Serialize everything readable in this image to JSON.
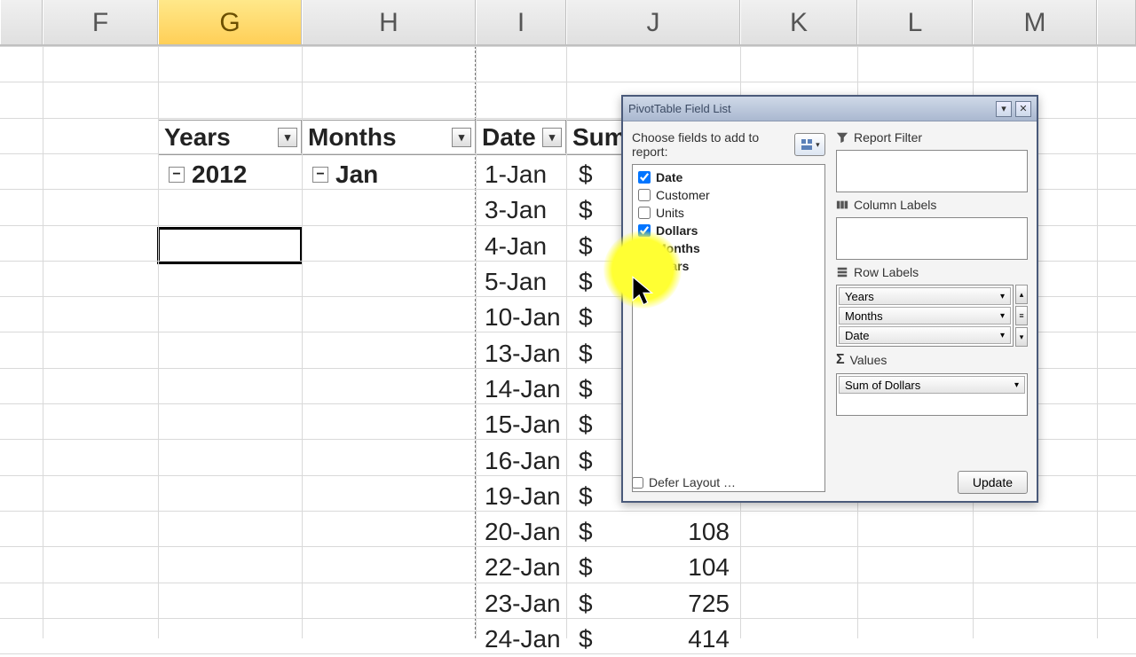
{
  "columns": [
    {
      "letter": "",
      "width": 48
    },
    {
      "letter": "F",
      "width": 130
    },
    {
      "letter": "G",
      "width": 162,
      "active": true
    },
    {
      "letter": "H",
      "width": 196
    },
    {
      "letter": "I",
      "width": 102
    },
    {
      "letter": "J",
      "width": 196
    },
    {
      "letter": "K",
      "width": 132
    },
    {
      "letter": "L",
      "width": 130
    },
    {
      "letter": "M",
      "width": 140
    },
    {
      "letter": "",
      "width": 44
    }
  ],
  "pivot": {
    "headers": {
      "years": "Years",
      "months": "Months",
      "date": "Date",
      "sum": "Sum"
    },
    "year": "2012",
    "month": "Jan",
    "rows": [
      {
        "date": "1-Jan",
        "d": "$",
        "v": ""
      },
      {
        "date": "3-Jan",
        "d": "$",
        "v": ""
      },
      {
        "date": "4-Jan",
        "d": "$",
        "v": ""
      },
      {
        "date": "5-Jan",
        "d": "$",
        "v": ""
      },
      {
        "date": "10-Jan",
        "d": "$",
        "v": ""
      },
      {
        "date": "13-Jan",
        "d": "$",
        "v": ""
      },
      {
        "date": "14-Jan",
        "d": "$",
        "v": ""
      },
      {
        "date": "15-Jan",
        "d": "$",
        "v": ""
      },
      {
        "date": "16-Jan",
        "d": "$",
        "v": ""
      },
      {
        "date": "19-Jan",
        "d": "$",
        "v": ""
      },
      {
        "date": "20-Jan",
        "d": "$",
        "v": "108"
      },
      {
        "date": "22-Jan",
        "d": "$",
        "v": "104"
      },
      {
        "date": "23-Jan",
        "d": "$",
        "v": "725"
      },
      {
        "date": "24-Jan",
        "d": "$",
        "v": "414"
      }
    ]
  },
  "pane": {
    "title": "PivotTable Field List",
    "choose": "Choose fields to add to report:",
    "fields": [
      {
        "name": "Date",
        "checked": true
      },
      {
        "name": "Customer",
        "checked": false
      },
      {
        "name": "Units",
        "checked": false
      },
      {
        "name": "Dollars",
        "checked": true
      },
      {
        "name": "Months",
        "checked": true
      },
      {
        "name": "Years",
        "checked": true
      }
    ],
    "zones": {
      "report_filter": "Report Filter",
      "column_labels": "Column Labels",
      "row_labels": "Row Labels",
      "values": "Values"
    },
    "row_items": [
      "Years",
      "Months",
      "Date"
    ],
    "value_items": [
      "Sum of Dollars"
    ],
    "defer": "Defer Layout …",
    "update": "Update"
  }
}
